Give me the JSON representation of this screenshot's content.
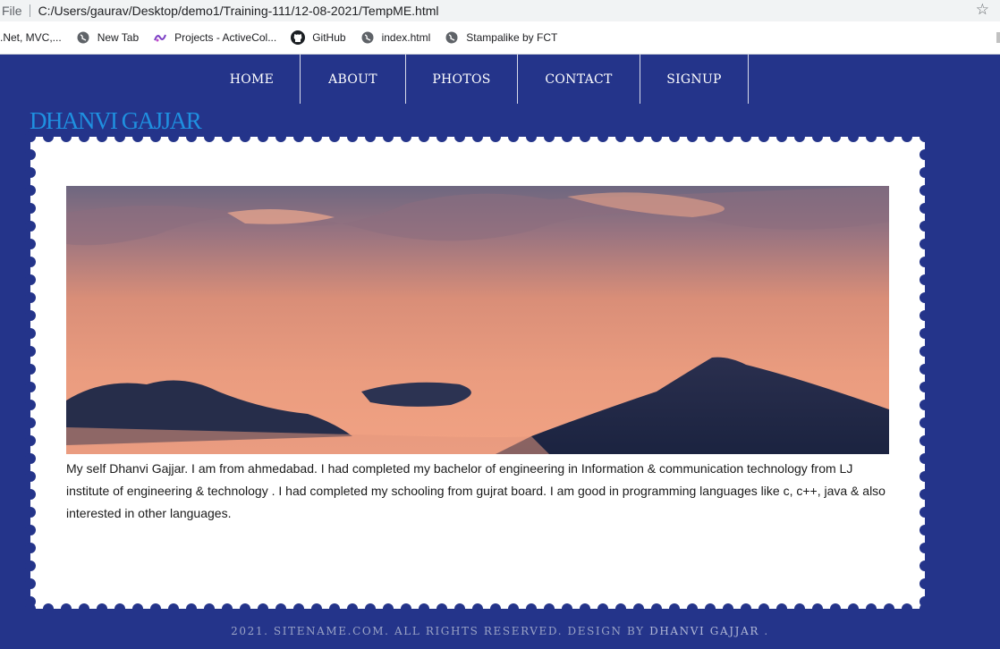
{
  "browser": {
    "file_label": "File",
    "url": "C:/Users/gaurav/Desktop/demo1/Training-111/12-08-2021/TempME.html",
    "bookmarks": [
      {
        "label": ".Net, MVC,...",
        "icon": "bookmark-cut-icon"
      },
      {
        "label": "New Tab",
        "icon": "globe-icon"
      },
      {
        "label": "Projects - ActiveCol...",
        "icon": "activecollab-icon"
      },
      {
        "label": "GitHub",
        "icon": "github-icon"
      },
      {
        "label": "index.html",
        "icon": "globe-icon"
      },
      {
        "label": "Stampalike by FCT",
        "icon": "globe-icon"
      }
    ]
  },
  "nav": {
    "items": [
      "HOME",
      "ABOUT",
      "PHOTOS",
      "CONTACT",
      "SIGNUP"
    ]
  },
  "site": {
    "title": "DHANVI GAJJAR"
  },
  "main": {
    "about_text": "My self Dhanvi Gajjar. I am from ahmedabad. I had completed my bachelor of engineering in Information & communication technology from LJ institute of engineering & technology . I had completed my schooling from gujrat board. I am good in programming languages like c, c++, java & also interested in other languages."
  },
  "footer": {
    "text": "2021. SITENAME.COM. ALL RIGHTS RESERVED. DESIGN BY",
    "link": "DHANVI GAJJAR",
    "end": "."
  },
  "colors": {
    "background": "#24348a",
    "title": "#1f90e0",
    "panel": "#ffffff"
  }
}
